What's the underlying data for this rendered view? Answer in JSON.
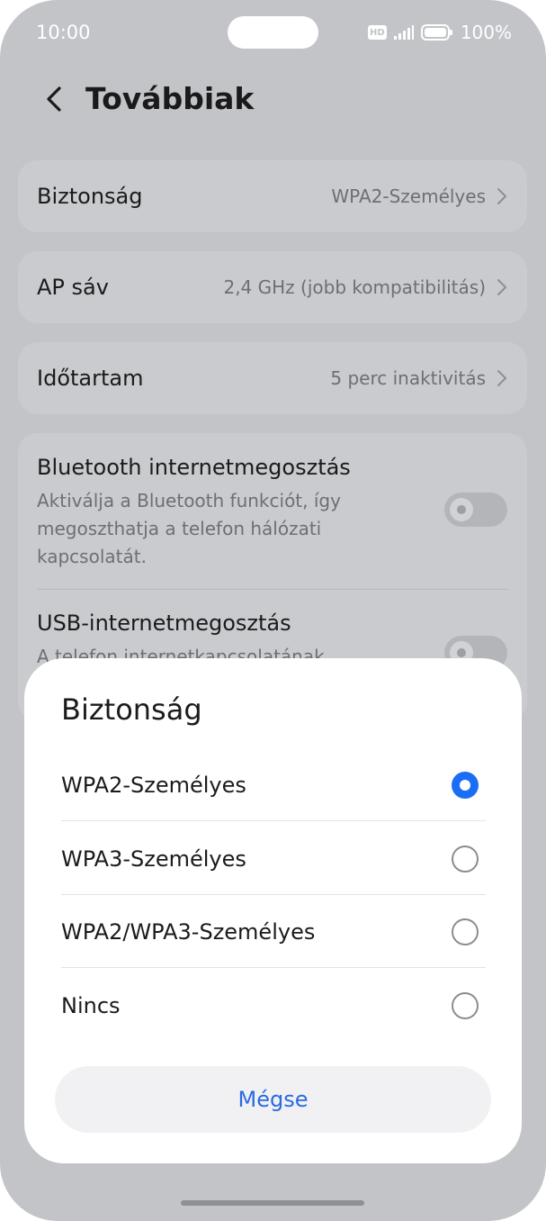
{
  "status_bar": {
    "time": "10:00",
    "hd_label": "HD",
    "battery_percent": "100%",
    "battery_level": 1.0
  },
  "header": {
    "title": "Továbbiak"
  },
  "settings": {
    "security": {
      "label": "Biztonság",
      "value": "WPA2-Személyes"
    },
    "ap_band": {
      "label": "AP sáv",
      "value": "2,4 GHz (jobb kompatibilitás)"
    },
    "timeout": {
      "label": "Időtartam",
      "value": "5 perc inaktivitás"
    },
    "bluetooth_tethering": {
      "title": "Bluetooth internetmegosztás",
      "description": "Aktiválja a Bluetooth funkciót, így megoszthatja a telefon hálózati kapcsolatát.",
      "enabled": false
    },
    "usb_tethering": {
      "title": "USB-internetmegosztás",
      "description": "A telefon internetkapcsolatának",
      "enabled": false
    }
  },
  "dialog": {
    "title": "Biztonság",
    "options": [
      {
        "label": "WPA2-Személyes",
        "selected": true
      },
      {
        "label": "WPA3-Személyes",
        "selected": false
      },
      {
        "label": "WPA2/WPA3-Személyes",
        "selected": false
      },
      {
        "label": "Nincs",
        "selected": false
      }
    ],
    "cancel_label": "Mégse"
  },
  "colors": {
    "accent": "#1b6ef3",
    "cancel_text": "#2a6be0",
    "dimmed_background": "#c3c4c8"
  }
}
